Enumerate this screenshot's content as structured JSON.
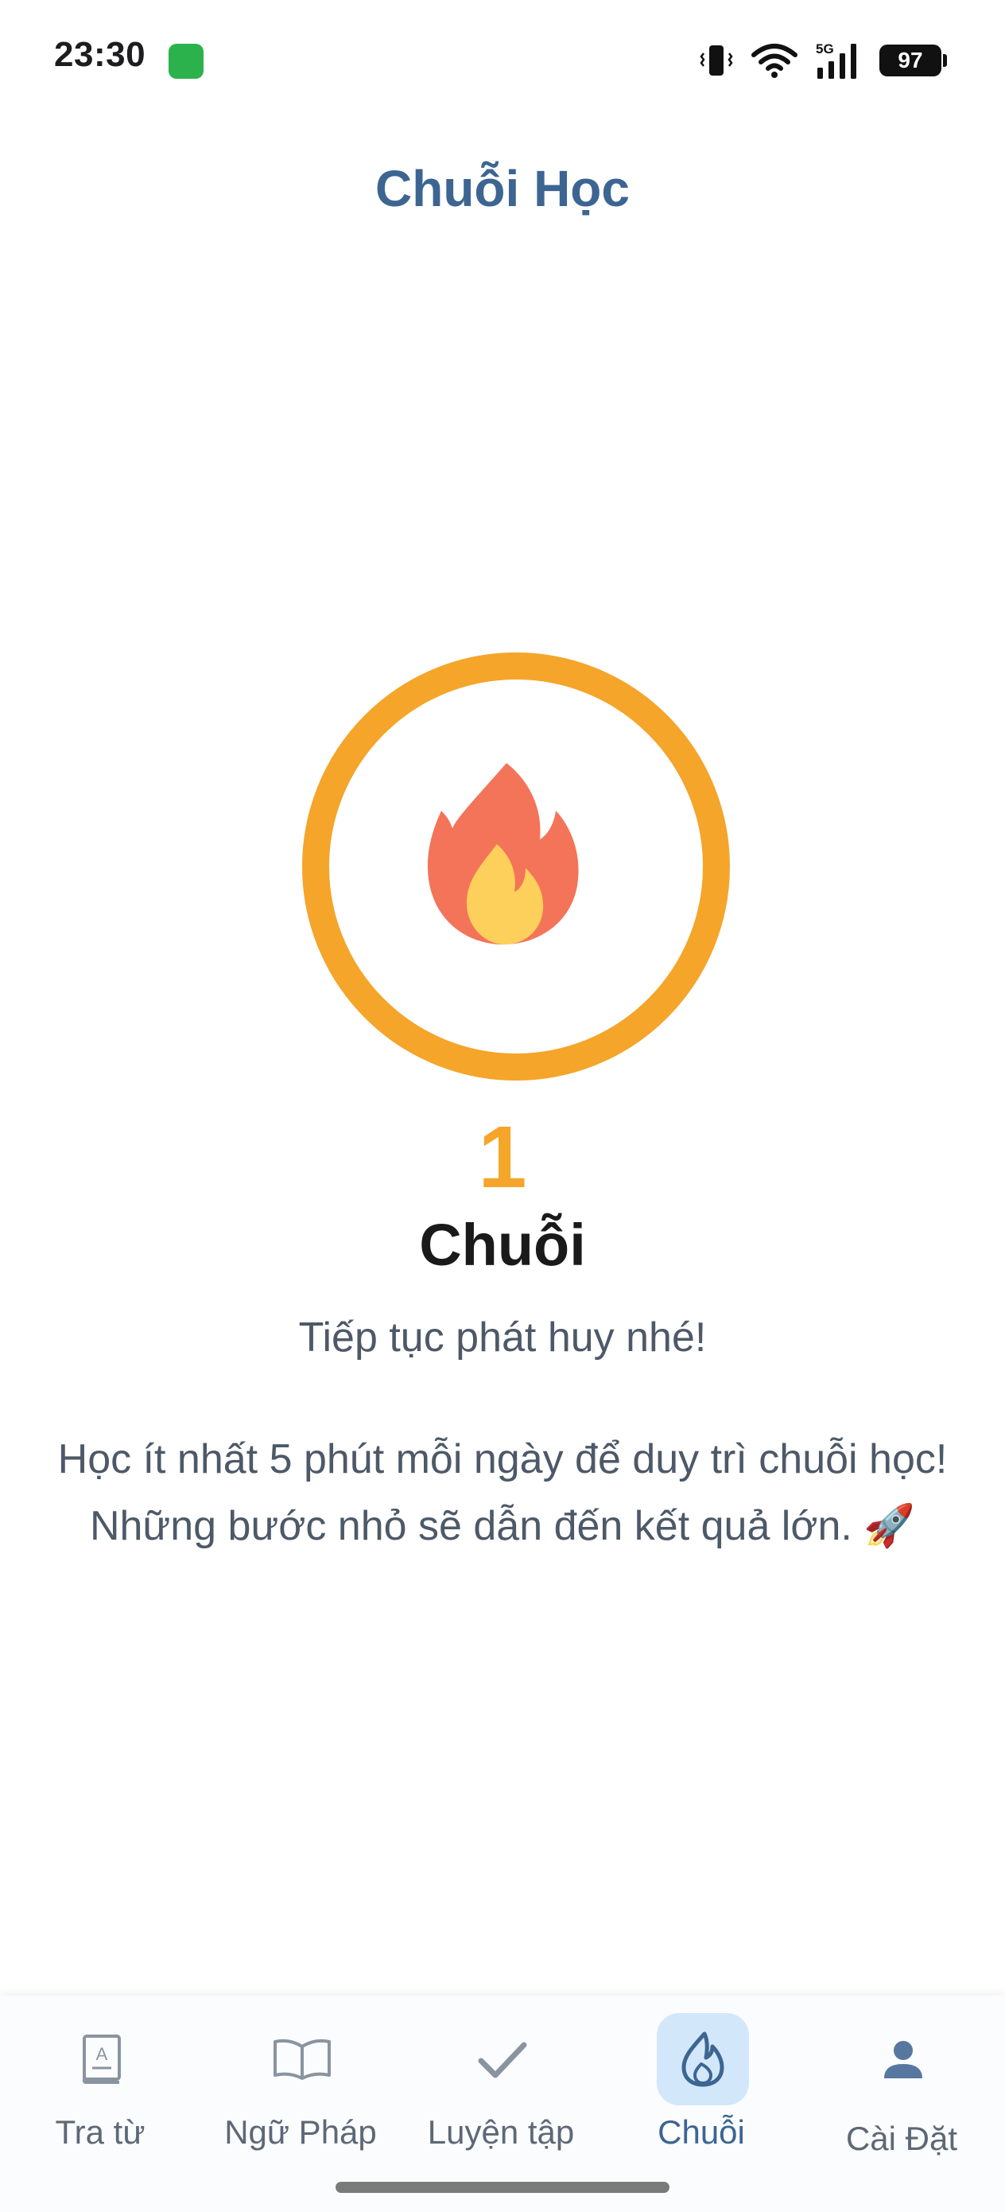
{
  "status_bar": {
    "time": "23:30",
    "network": "5G",
    "battery": "97"
  },
  "header": {
    "title": "Chuỗi Học"
  },
  "streak": {
    "count": "1",
    "label": "Chuỗi",
    "subtitle": "Tiếp tục phát huy nhé!",
    "message": "Học ít nhất 5 phút mỗi ngày để duy trì chuỗi học! Những bước nhỏ sẽ dẫn đến kết quả lớn. 🚀",
    "icon": "fire-icon",
    "ring_color": "#f4a52a"
  },
  "bottom_nav": {
    "active": "Chuỗi",
    "items": [
      {
        "label": "Tra từ",
        "icon": "dictionary-icon"
      },
      {
        "label": "Ngữ Pháp",
        "icon": "open-book-icon"
      },
      {
        "label": "Luyện tập",
        "icon": "check-icon"
      },
      {
        "label": "Chuỗi",
        "icon": "flame-icon"
      },
      {
        "label": "Cài Đặt",
        "icon": "person-icon"
      }
    ]
  },
  "colors": {
    "accent": "#3c6591",
    "streak": "#f4a52a",
    "active_nav_bg": "#d3e7fb"
  }
}
